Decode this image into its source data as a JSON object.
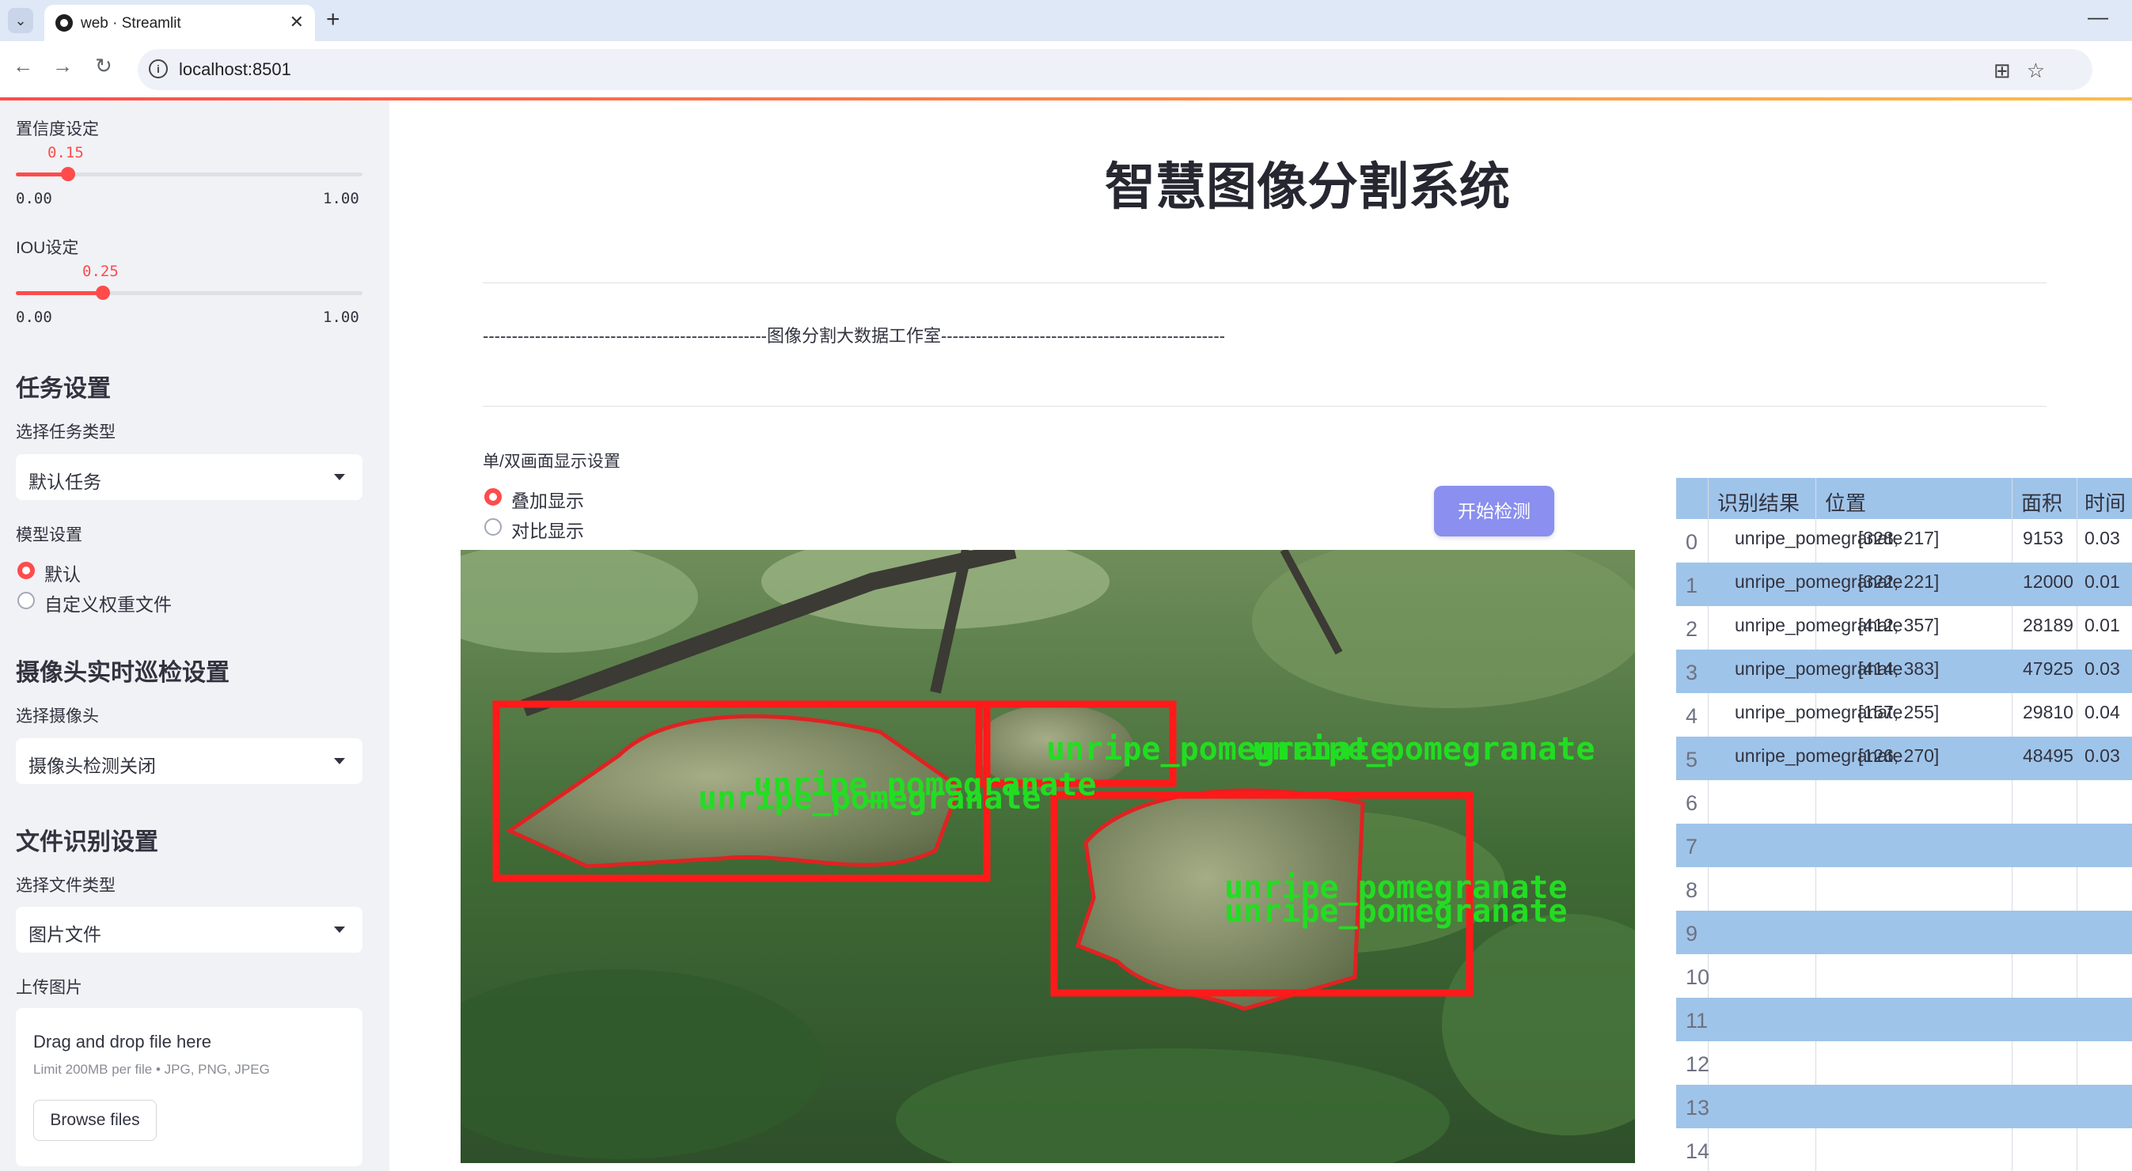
{
  "browser": {
    "tab_title": "web · Streamlit",
    "url": "localhost:8501"
  },
  "sidebar": {
    "confidence_label": "置信度设定",
    "confidence_value": "0.15",
    "confidence_fraction": 0.15,
    "confidence_min": "0.00",
    "confidence_max": "1.00",
    "iou_label": "IOU设定",
    "iou_value": "0.25",
    "iou_fraction": 0.25,
    "iou_min": "0.00",
    "iou_max": "1.00",
    "task_heading": "任务设置",
    "task_type_label": "选择任务类型",
    "task_type_value": "默认任务",
    "model_label": "模型设置",
    "model_options": [
      "默认",
      "自定义权重文件"
    ],
    "model_selected": 0,
    "camera_heading": "摄像头实时巡检设置",
    "camera_label": "选择摄像头",
    "camera_value": "摄像头检测关闭",
    "file_heading": "文件识别设置",
    "file_type_label": "选择文件类型",
    "file_type_value": "图片文件",
    "upload_label": "上传图片",
    "upload_title": "Drag and drop file here",
    "upload_limit": "Limit 200MB per file • JPG, PNG, JPEG",
    "browse_label": "Browse files"
  },
  "main": {
    "title": "智慧图像分割系统",
    "divider_text": "-------------------------------------------------图像分割大数据工作室-------------------------------------------------",
    "display_mode_label": "单/双画面显示设置",
    "display_options": [
      "叠加显示",
      "对比显示"
    ],
    "display_selected": 0,
    "start_button": "开始检测"
  },
  "detections": {
    "label_text": "unripe_pomegranate",
    "colors": {
      "box": "#ff1a1a",
      "label": "#22dd22"
    }
  },
  "table": {
    "columns": [
      "识别结果",
      "位置",
      "面积",
      "时间"
    ],
    "rows": [
      {
        "idx": "0",
        "result": "unripe_pomegranate",
        "pos": "[328, 217]",
        "area": "9153",
        "time": "0.03"
      },
      {
        "idx": "1",
        "result": "unripe_pomegranate",
        "pos": "[322, 221]",
        "area": "12000",
        "time": "0.01"
      },
      {
        "idx": "2",
        "result": "unripe_pomegranate",
        "pos": "[412, 357]",
        "area": "28189",
        "time": "0.01"
      },
      {
        "idx": "3",
        "result": "unripe_pomegranate",
        "pos": "[414, 383]",
        "area": "47925",
        "time": "0.03"
      },
      {
        "idx": "4",
        "result": "unripe_pomegranate",
        "pos": "[157, 255]",
        "area": "29810",
        "time": "0.04"
      },
      {
        "idx": "5",
        "result": "unripe_pomegranate",
        "pos": "[126, 270]",
        "area": "48495",
        "time": "0.03"
      },
      {
        "idx": "6"
      },
      {
        "idx": "7"
      },
      {
        "idx": "8"
      },
      {
        "idx": "9"
      },
      {
        "idx": "10"
      },
      {
        "idx": "11"
      },
      {
        "idx": "12"
      },
      {
        "idx": "13"
      },
      {
        "idx": "14"
      }
    ]
  }
}
